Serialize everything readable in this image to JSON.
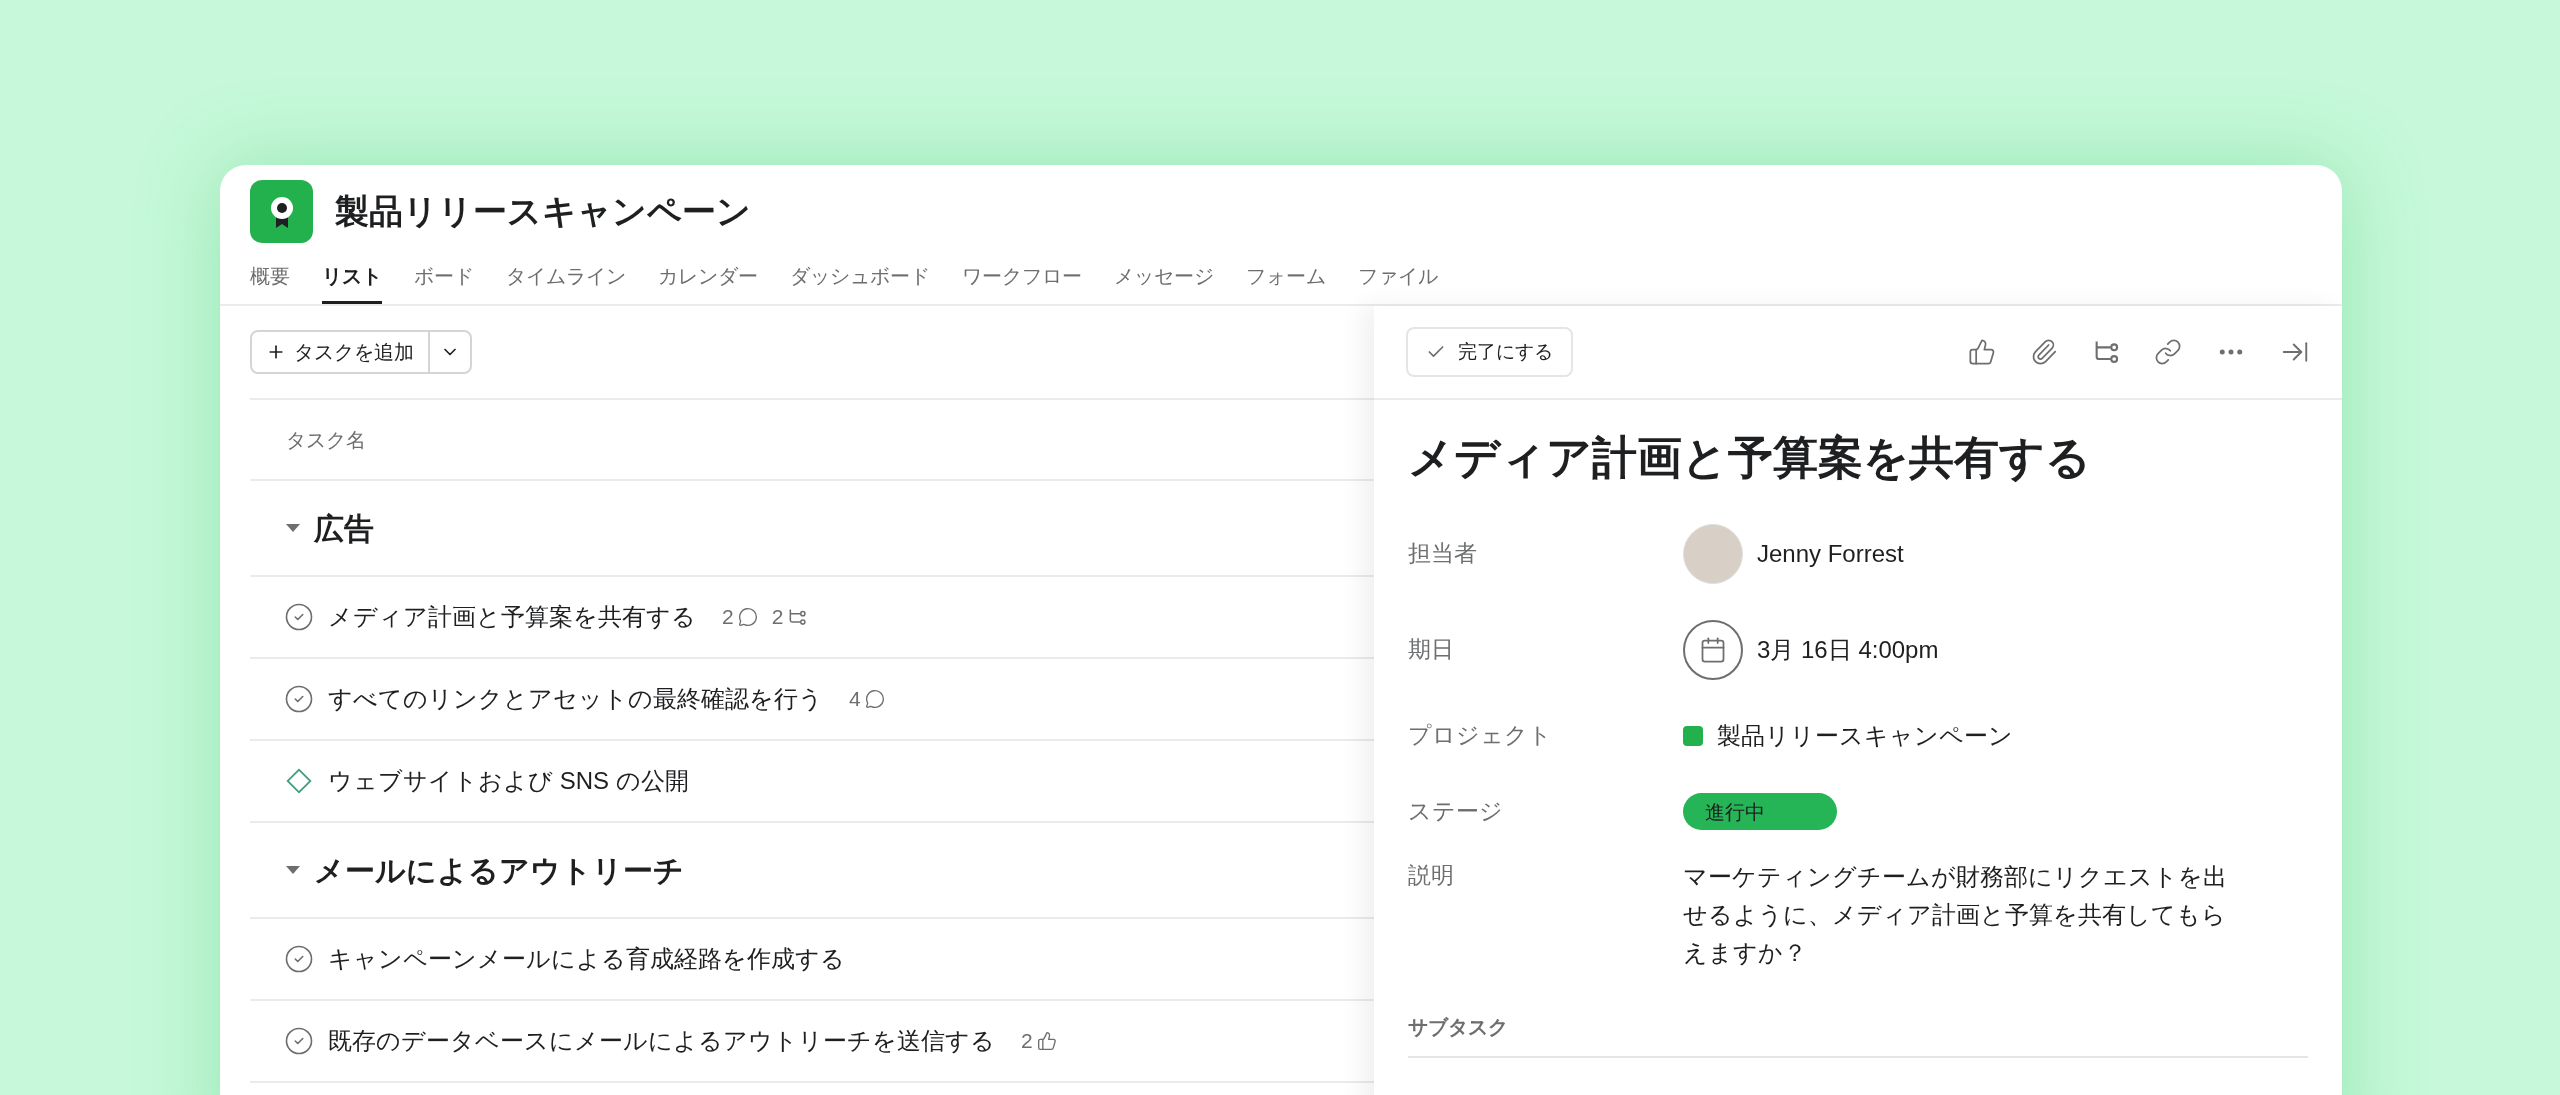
{
  "project": {
    "title": "製品リリースキャンペーン"
  },
  "tabs": [
    {
      "label": "概要",
      "selected": false
    },
    {
      "label": "リスト",
      "selected": true
    },
    {
      "label": "ボード",
      "selected": false
    },
    {
      "label": "タイムライン",
      "selected": false
    },
    {
      "label": "カレンダー",
      "selected": false
    },
    {
      "label": "ダッシュボード",
      "selected": false
    },
    {
      "label": "ワークフロー",
      "selected": false
    },
    {
      "label": "メッセージ",
      "selected": false
    },
    {
      "label": "フォーム",
      "selected": false
    },
    {
      "label": "ファイル",
      "selected": false
    }
  ],
  "add_task": {
    "label": "タスクを追加"
  },
  "list": {
    "column": "タスク名",
    "sections": [
      {
        "title": "広告",
        "expanded": true,
        "tasks": [
          {
            "kind": "task",
            "name": "メディア計画と予算案を共有する",
            "counts": [
              {
                "kind": "comments",
                "value": "2"
              },
              {
                "kind": "subtasks",
                "value": "2"
              }
            ]
          },
          {
            "kind": "task",
            "name": "すべてのリンクとアセットの最終確認を行う",
            "counts": [
              {
                "kind": "comments",
                "value": "4"
              }
            ]
          },
          {
            "kind": "milestone",
            "name": "ウェブサイトおよび SNS の公開"
          }
        ]
      },
      {
        "title": "メールによるアウトリーチ",
        "expanded": true,
        "tasks": [
          {
            "kind": "task",
            "name": "キャンペーンメールによる育成経路を作成する"
          },
          {
            "kind": "task",
            "name": "既存のデータベースにメールによるアウトリーチを送信する",
            "counts": [
              {
                "kind": "likes",
                "value": "2"
              }
            ]
          }
        ]
      }
    ]
  },
  "detail": {
    "complete_button": "完了にする",
    "title": "メディア計画と予算案を共有する",
    "fields": [
      {
        "kind": "person",
        "label": "担当者",
        "value": "Jenny Forrest"
      },
      {
        "kind": "date",
        "label": "期日",
        "value": "3月 16日 4:00pm"
      },
      {
        "kind": "project",
        "label": "プロジェクト",
        "value": "製品リリースキャンペーン",
        "color": "#22b14c"
      },
      {
        "kind": "stage",
        "label": "ステージ",
        "value": "進行中",
        "color": "#25b556"
      },
      {
        "kind": "text",
        "label": "説明",
        "value": "マーケティングチームが財務部にリクエストを出せるように、メディア計画と予算を共有してもらえますか？"
      }
    ],
    "subtasks_heading": "サブタスク"
  }
}
